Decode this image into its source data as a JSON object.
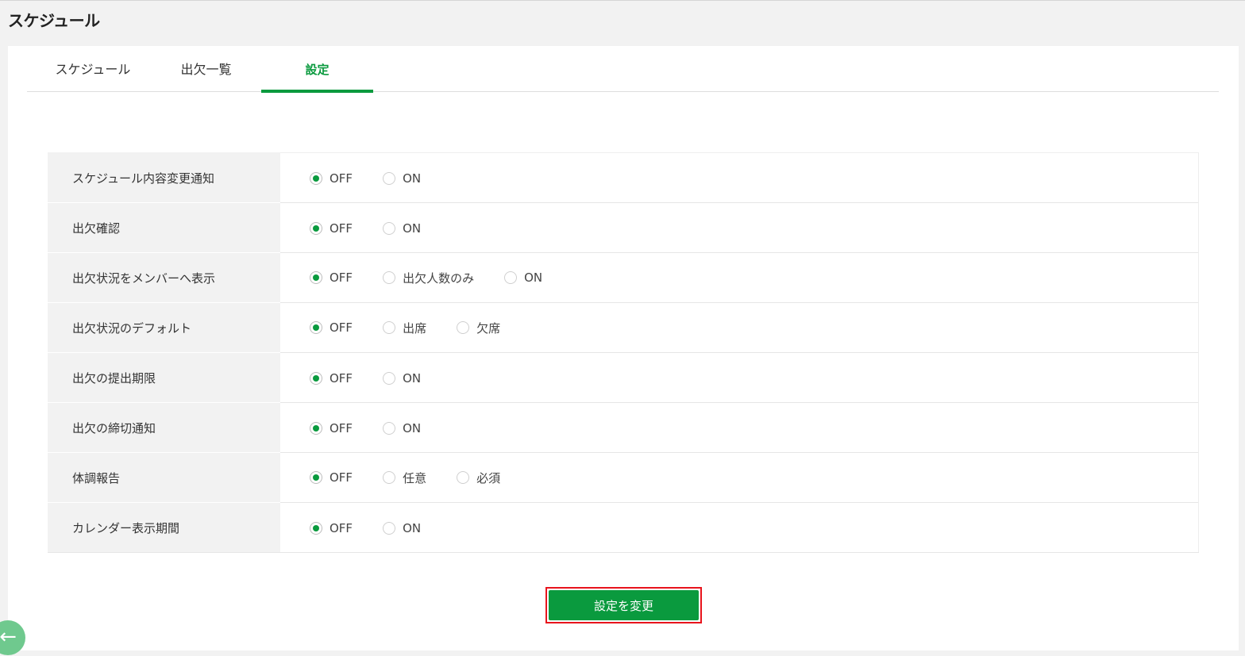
{
  "page": {
    "title": "スケジュール"
  },
  "tabs": [
    {
      "label": "スケジュール",
      "active": false
    },
    {
      "label": "出欠一覧",
      "active": false
    },
    {
      "label": "設定",
      "active": true
    }
  ],
  "settings": [
    {
      "label": "スケジュール内容変更通知",
      "options": [
        "OFF",
        "ON"
      ],
      "selected": 0
    },
    {
      "label": "出欠確認",
      "options": [
        "OFF",
        "ON"
      ],
      "selected": 0
    },
    {
      "label": "出欠状況をメンバーへ表示",
      "options": [
        "OFF",
        "出欠人数のみ",
        "ON"
      ],
      "selected": 0
    },
    {
      "label": "出欠状況のデフォルト",
      "options": [
        "OFF",
        "出席",
        "欠席"
      ],
      "selected": 0
    },
    {
      "label": "出欠の提出期限",
      "options": [
        "OFF",
        "ON"
      ],
      "selected": 0
    },
    {
      "label": "出欠の締切通知",
      "options": [
        "OFF",
        "ON"
      ],
      "selected": 0
    },
    {
      "label": "体調報告",
      "options": [
        "OFF",
        "任意",
        "必須"
      ],
      "selected": 0
    },
    {
      "label": "カレンダー表示期間",
      "options": [
        "OFF",
        "ON"
      ],
      "selected": 0
    }
  ],
  "submit": {
    "label": "設定を変更"
  },
  "back": {
    "icon": "arrow-left-icon",
    "glyph": "←"
  },
  "colors": {
    "accent": "#0a9a3e",
    "highlight_border": "#e8141c",
    "label_bg": "#f2f2f2"
  }
}
